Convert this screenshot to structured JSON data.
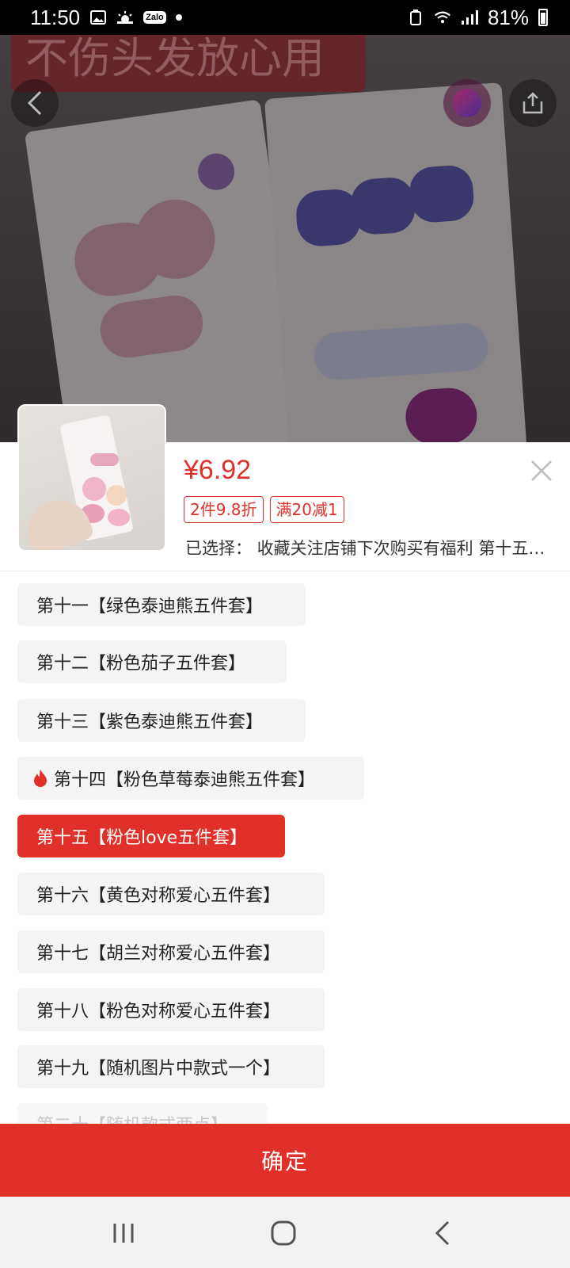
{
  "status_bar": {
    "time": "11:50",
    "zalo_label": "Zalo",
    "battery": "81%"
  },
  "hero": {
    "banner_text": "不伤头发放心用"
  },
  "product": {
    "price": "¥6.92",
    "tags": [
      "2件9.8折",
      "满20减1"
    ],
    "selected_text": "已选择：  收藏关注店铺下次购买有福利  第十五【粉色love五件套】"
  },
  "options": [
    {
      "label": "第十一【绿色泰迪熊五件套】",
      "hot": false,
      "selected": false
    },
    {
      "label": "第十二【粉色茄子五件套】",
      "hot": false,
      "selected": false
    },
    {
      "label": "第十三【紫色泰迪熊五件套】",
      "hot": false,
      "selected": false
    },
    {
      "label": "第十四【粉色草莓泰迪熊五件套】",
      "hot": true,
      "selected": false
    },
    {
      "label": "第十五【粉色love五件套】",
      "hot": false,
      "selected": true
    },
    {
      "label": "第十六【黄色对称爱心五件套】",
      "hot": false,
      "selected": false
    },
    {
      "label": "第十七【胡兰对称爱心五件套】",
      "hot": false,
      "selected": false
    },
    {
      "label": "第十八【粉色对称爱心五件套】",
      "hot": false,
      "selected": false
    },
    {
      "label": "第十九【随机图片中款式一个】",
      "hot": false,
      "selected": false
    },
    {
      "label": "第二十【随机款式两点】",
      "hot": false,
      "selected": false
    }
  ],
  "confirm_label": "确定",
  "colors": {
    "accent": "#e1302a",
    "chip_bg": "#f4f4f4"
  },
  "icons": {
    "back": "chevron-left-icon",
    "share": "share-icon",
    "close": "close-icon",
    "hot": "fire-icon",
    "nav_recent": "recent-apps-icon",
    "nav_home": "home-icon",
    "nav_back": "back-icon"
  }
}
